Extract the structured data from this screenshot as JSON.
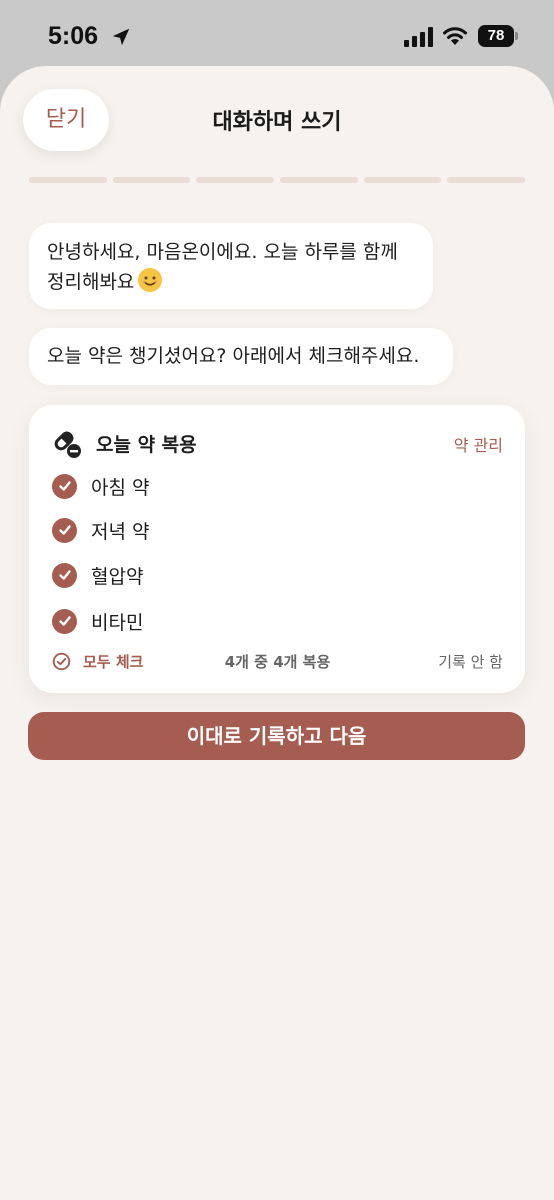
{
  "status_bar": {
    "time": "5:06",
    "battery": "78",
    "icons": [
      "location-arrow-icon",
      "signal-icon",
      "wifi-icon",
      "battery-icon"
    ]
  },
  "header": {
    "close_label": "닫기",
    "title": "대화하며 쓰기"
  },
  "progress": {
    "segments": 6,
    "completed": 0
  },
  "chat": {
    "message1_line1": "안녕하세요, 마음온이에요. 오늘 하루를 함께",
    "message1_line2": "정리해봐요",
    "message1_emoji": "smiling-face-icon",
    "message2": "오늘 약은 챙기셨어요? 아래에서 체크해주세요."
  },
  "medication_card": {
    "icon": "pill-icon",
    "title": "오늘 약 복용",
    "manage_label": "약 관리",
    "items": [
      {
        "label": "아침 약",
        "checked": true
      },
      {
        "label": "저녁 약",
        "checked": true
      },
      {
        "label": "혈압약",
        "checked": true
      },
      {
        "label": "비타민",
        "checked": true
      }
    ],
    "check_all_label": "모두 체크",
    "count_text": "4개 중 4개 복용",
    "no_record_label": "기록 안 함"
  },
  "submit_label": "이대로 기록하고 다음",
  "colors": {
    "accent": "#a55d52",
    "background": "#f5f2f0",
    "progress_track": "#eadcd6"
  }
}
